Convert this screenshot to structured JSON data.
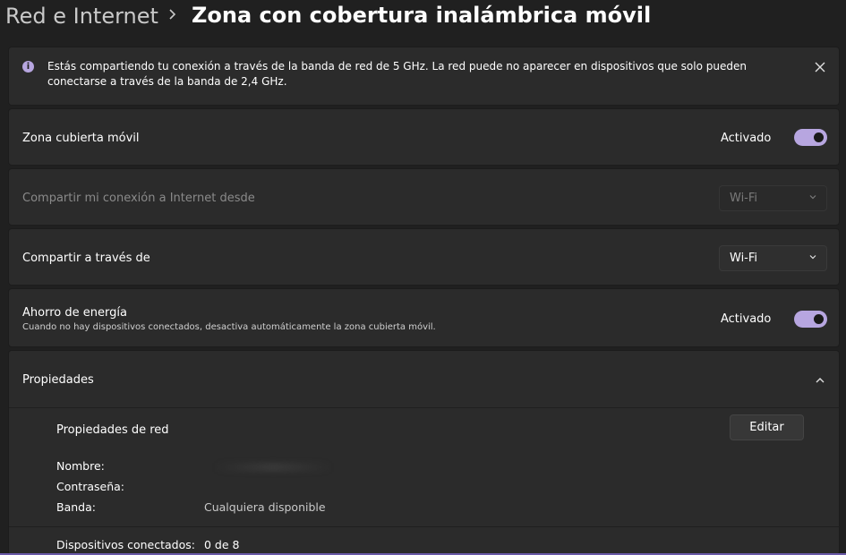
{
  "breadcrumb": {
    "parent": "Red e Internet",
    "current": "Zona con cobertura inalámbrica móvil"
  },
  "banner": {
    "text": "Estás compartiendo tu conexión a través de la banda de red de 5 GHz. La red puede no aparecer en dispositivos que solo pueden conectarse a través de la banda de 2,4 GHz.",
    "icon": "info-icon",
    "close_icon": "close-icon"
  },
  "rows": {
    "hotspot": {
      "label": "Zona cubierta móvil",
      "state": "Activado",
      "on": true
    },
    "share_from": {
      "label": "Compartir mi conexión a Internet desde",
      "value": "Wi-Fi",
      "disabled": true
    },
    "share_via": {
      "label": "Compartir a través de",
      "value": "Wi-Fi"
    },
    "power_saving": {
      "label": "Ahorro de energía",
      "description": "Cuando no hay dispositivos conectados, desactiva automáticamente la zona cubierta móvil.",
      "state": "Activado",
      "on": true
    }
  },
  "properties": {
    "header": "Propiedades",
    "network_title": "Propiedades de red",
    "edit_label": "Editar",
    "name_label": "Nombre:",
    "name_value": "",
    "password_label": "Contraseña:",
    "password_value": "",
    "band_label": "Banda:",
    "band_value": "Cualquiera disponible",
    "devices_label": "Dispositivos conectados:",
    "devices_value": "0 de 8"
  },
  "colors": {
    "accent": "#b7a6e0",
    "background": "#202020",
    "card": "#2b2b2b"
  }
}
